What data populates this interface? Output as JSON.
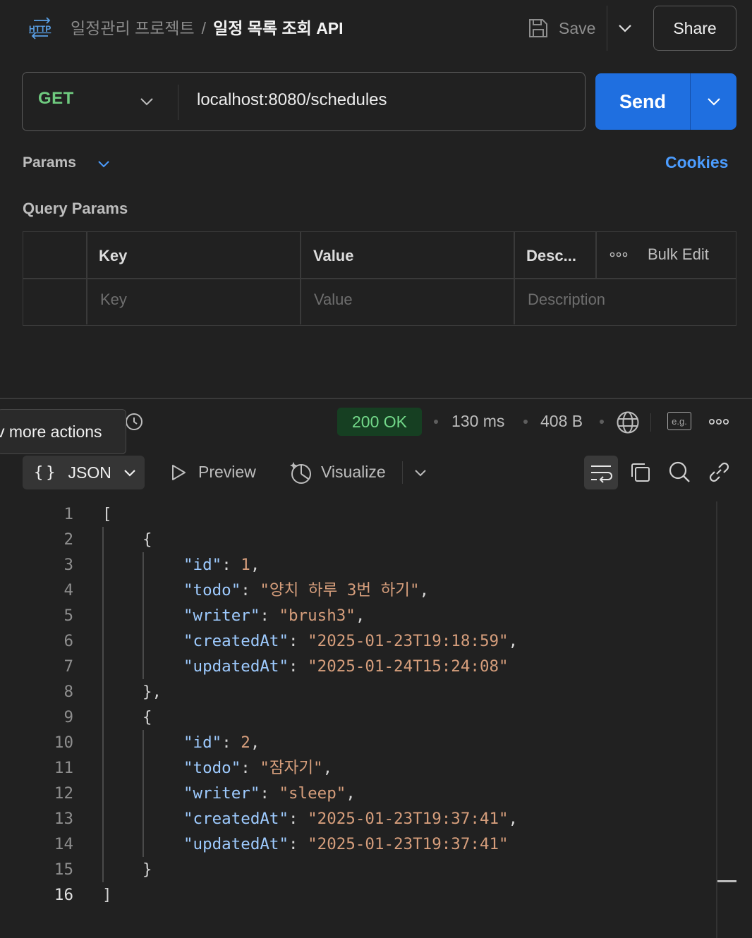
{
  "header": {
    "icon": "http-icon",
    "breadcrumb_parent": "일정관리 프로젝트",
    "breadcrumb_separator": "/",
    "breadcrumb_current": "일정 목록 조회 API",
    "save_label": "Save",
    "share_label": "Share"
  },
  "request": {
    "method": "GET",
    "url": "localhost:8080/schedules",
    "send_label": "Send"
  },
  "params": {
    "section_label": "Params",
    "cookies_label": "Cookies",
    "query_params_label": "Query Params",
    "columns": [
      "Key",
      "Value",
      "Desc..."
    ],
    "bulk_edit_label": "Bulk Edit",
    "placeholders": {
      "key": "Key",
      "value": "Value",
      "description": "Description"
    }
  },
  "response": {
    "tooltip": "v more actions",
    "status": "200 OK",
    "time": "130 ms",
    "size": "408 B",
    "example_icon_label": "e.g.",
    "format_label": "JSON",
    "preview_label": "Preview",
    "visualize_label": "Visualize",
    "status_color": "#73d98a"
  },
  "code": {
    "line_numbers": [
      "1",
      "2",
      "3",
      "4",
      "5",
      "6",
      "7",
      "8",
      "9",
      "10",
      "11",
      "12",
      "13",
      "14",
      "15",
      "16"
    ],
    "lines": {
      "l1": "[",
      "l2": "{",
      "l3_key": "\"id\"",
      "l3_val": "1",
      "l4_key": "\"todo\"",
      "l4_val": "\"양치 하루 3번 하기\"",
      "l5_key": "\"writer\"",
      "l5_val": "\"brush3\"",
      "l6_key": "\"createdAt\"",
      "l6_val": "\"2025-01-23T19:18:59\"",
      "l7_key": "\"updatedAt\"",
      "l7_val": "\"2025-01-24T15:24:08\"",
      "l8": "},",
      "l9": "{",
      "l10_key": "\"id\"",
      "l10_val": "2",
      "l11_key": "\"todo\"",
      "l11_val": "\"잠자기\"",
      "l12_key": "\"writer\"",
      "l12_val": "\"sleep\"",
      "l13_key": "\"createdAt\"",
      "l13_val": "\"2025-01-23T19:37:41\"",
      "l14_key": "\"updatedAt\"",
      "l14_val": "\"2025-01-23T19:37:41\"",
      "l15": "}",
      "l16": "]"
    }
  }
}
